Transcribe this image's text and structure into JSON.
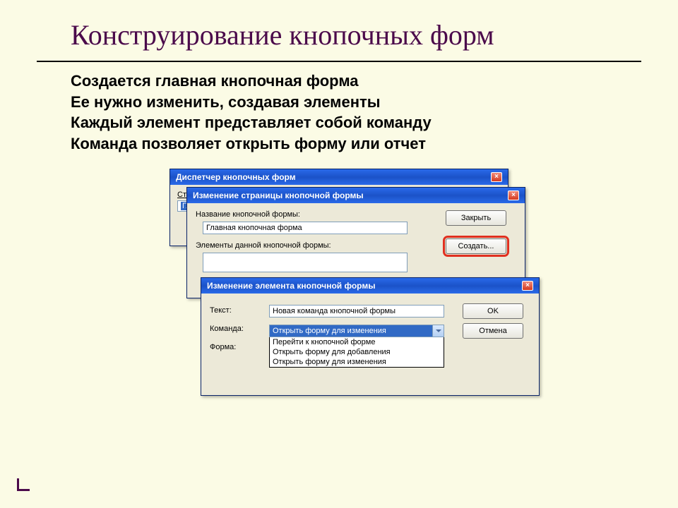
{
  "slide": {
    "title": "Конструирование кнопочных форм",
    "body_lines": [
      "Создается главная кнопочная форма",
      "Ее нужно изменить, создавая  элементы",
      "Каждый элемент представляет собой команду",
      "Команда позволяет открыть форму или отчет"
    ]
  },
  "dialog1": {
    "title": "Диспетчер кнопочных форм",
    "pages_prefix": "Стр",
    "selected": "Глав"
  },
  "dialog2": {
    "title": "Изменение страницы кнопочной формы",
    "label_name": "Название кнопочной формы:",
    "value_name": "Главная кнопочная форма",
    "label_elements": "Элементы данной кнопочной формы:",
    "btn_close": "Закрыть",
    "btn_create": "Создать..."
  },
  "dialog3": {
    "title": "Изменение элемента кнопочной формы",
    "label_text": "Текст:",
    "value_text": "Новая команда кнопочной формы",
    "label_command": "Команда:",
    "value_command": "Открыть форму для изменения",
    "label_form": "Форма:",
    "dropdown": [
      "Перейти к кнопочной форме",
      "Открыть форму для добавления",
      "Открыть форму для изменения"
    ],
    "btn_ok": "OK",
    "btn_cancel": "Отмена"
  }
}
